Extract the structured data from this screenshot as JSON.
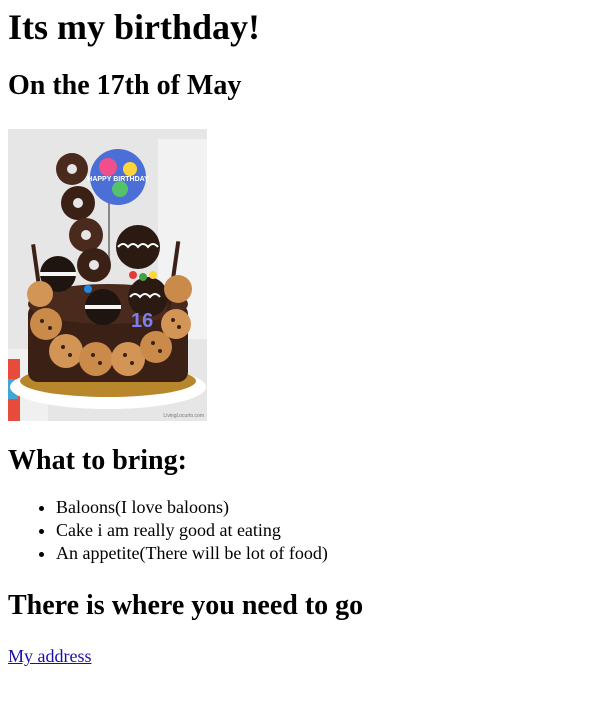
{
  "page": {
    "title": "Its my birthday!",
    "subtitle": "On the 17th of May",
    "bring_heading": "What to bring:",
    "bring_items": [
      "Baloons(I love baloons)",
      "Cake i am really good at eating",
      "An appetite(There will be lot of food)"
    ],
    "go_heading": "There is where you need to go",
    "address_link": "My address"
  },
  "image": {
    "icon": "birthday-cake-photo",
    "balloon_text": "HAPPY BIRTHDAY",
    "candle_text": "16",
    "watermark": "LivingLocurto.com"
  },
  "colors": {
    "link": "#1a0dab",
    "cake_chocolate": "#3b2016",
    "cookie": "#c98a4a"
  }
}
